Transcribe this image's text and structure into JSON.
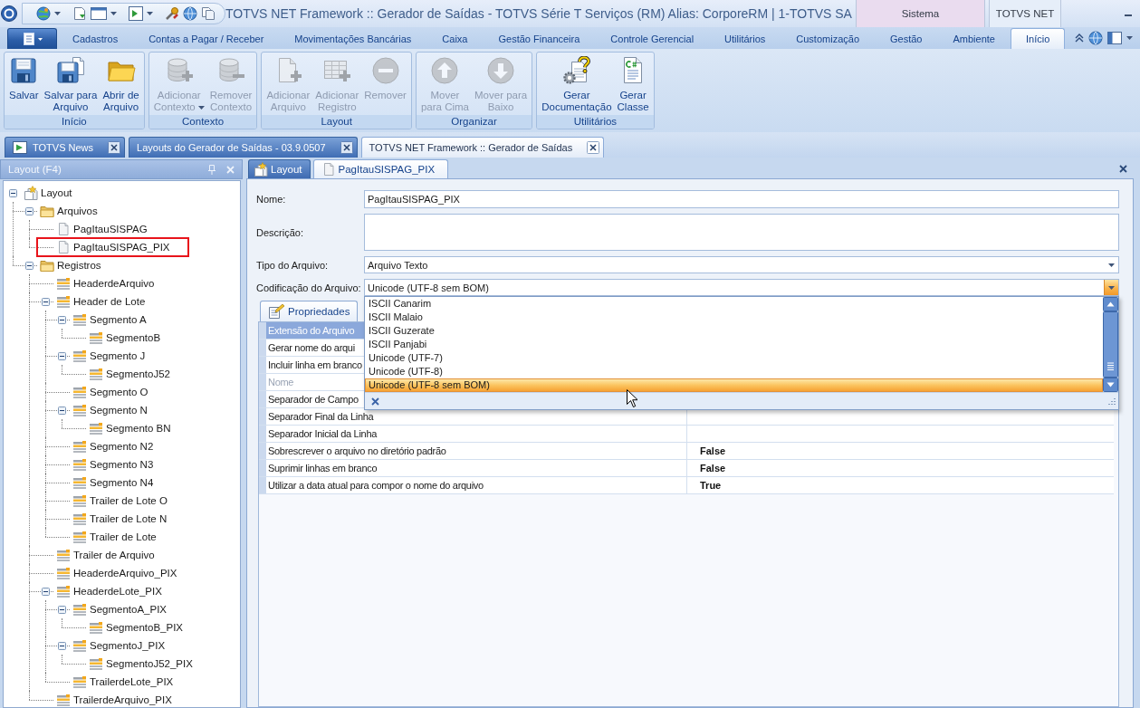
{
  "title_bar": {
    "title": "TOTVS NET Framework :: Gerador de Saídas - TOTVS Série T Serviços (RM) Alias: CorporeRM | 1-TOTVS SA",
    "context_groups": [
      {
        "label": "Sistema",
        "color": "#eadcef"
      },
      {
        "label": "TOTVS NET",
        "color": "#e6eef9"
      }
    ]
  },
  "menu_tabs": [
    {
      "label": "Cadastros",
      "selected": false
    },
    {
      "label": "Contas a Pagar / Receber",
      "selected": false
    },
    {
      "label": "Movimentações Bancárias",
      "selected": false
    },
    {
      "label": "Caixa",
      "selected": false
    },
    {
      "label": "Gestão Financeira",
      "selected": false
    },
    {
      "label": "Controle Gerencial",
      "selected": false
    },
    {
      "label": "Utilitários",
      "selected": false
    },
    {
      "label": "Customização",
      "selected": false
    },
    {
      "label": "Gestão",
      "selected": false
    },
    {
      "label": "Ambiente",
      "selected": false
    },
    {
      "label": "Início",
      "selected": true
    }
  ],
  "ribbon": {
    "groups": [
      {
        "label": "Início",
        "buttons": [
          {
            "label": "Salvar",
            "disabled": false,
            "menu": false
          },
          {
            "label": "Salvar para\nArquivo",
            "disabled": false,
            "menu": false
          },
          {
            "label": "Abrir de\nArquivo",
            "disabled": false,
            "menu": false
          }
        ]
      },
      {
        "label": "Contexto",
        "buttons": [
          {
            "label": "Adicionar\nContexto",
            "disabled": true,
            "menu": true
          },
          {
            "label": "Remover\nContexto",
            "disabled": true,
            "menu": false
          }
        ]
      },
      {
        "label": "Layout",
        "buttons": [
          {
            "label": "Adicionar\nArquivo",
            "disabled": true,
            "menu": false
          },
          {
            "label": "Adicionar\nRegistro",
            "disabled": true,
            "menu": false
          },
          {
            "label": "Remover",
            "disabled": true,
            "menu": false
          }
        ]
      },
      {
        "label": "Organizar",
        "buttons": [
          {
            "label": "Mover\npara Cima",
            "disabled": true,
            "menu": false
          },
          {
            "label": "Mover para\nBaixo",
            "disabled": true,
            "menu": false
          }
        ]
      },
      {
        "label": "Utilitários",
        "buttons": [
          {
            "label": "Gerar\nDocumentação",
            "disabled": false,
            "menu": false
          },
          {
            "label": "Gerar\nClasse",
            "disabled": false,
            "menu": false
          }
        ]
      }
    ]
  },
  "document_tabs": [
    {
      "label": "TOTVS News",
      "selected": false
    },
    {
      "label": "Layouts do Gerador de Saídas - 03.9.0507",
      "selected": false
    },
    {
      "label": "TOTVS NET Framework :: Gerador de Saídas",
      "selected": true
    }
  ],
  "layout_panel": {
    "title": "Layout (F4)",
    "tree": [
      {
        "label": "Layout",
        "kind": "layout",
        "expanded": true,
        "children": [
          {
            "label": "Arquivos",
            "kind": "folder",
            "expanded": true,
            "children": [
              {
                "label": "PagItauSISPAG",
                "kind": "file",
                "highlighted": false
              },
              {
                "label": "PagItauSISPAG_PIX",
                "kind": "file",
                "highlighted": true
              }
            ]
          },
          {
            "label": "Registros",
            "kind": "folder",
            "expanded": true,
            "children": [
              {
                "label": "HeaderdeArquivo",
                "kind": "record"
              },
              {
                "label": "Header de Lote",
                "kind": "record",
                "expanded": true,
                "children": [
                  {
                    "label": "Segmento A",
                    "kind": "record",
                    "expanded": true,
                    "children": [
                      {
                        "label": "SegmentoB",
                        "kind": "record"
                      }
                    ]
                  },
                  {
                    "label": "Segmento J",
                    "kind": "record",
                    "expanded": true,
                    "children": [
                      {
                        "label": "SegmentoJ52",
                        "kind": "record"
                      }
                    ]
                  },
                  {
                    "label": "Segmento O",
                    "kind": "record"
                  },
                  {
                    "label": "Segmento N",
                    "kind": "record",
                    "expanded": true,
                    "children": [
                      {
                        "label": "Segmento BN",
                        "kind": "record"
                      }
                    ]
                  },
                  {
                    "label": "Segmento N2",
                    "kind": "record"
                  },
                  {
                    "label": "Segmento N3",
                    "kind": "record"
                  },
                  {
                    "label": "Segmento N4",
                    "kind": "record"
                  },
                  {
                    "label": "Trailer de Lote O",
                    "kind": "record"
                  },
                  {
                    "label": "Trailer de Lote N",
                    "kind": "record"
                  },
                  {
                    "label": "Trailer de Lote",
                    "kind": "record"
                  }
                ]
              },
              {
                "label": "Trailer de Arquivo",
                "kind": "record"
              },
              {
                "label": "HeaderdeArquivo_PIX",
                "kind": "record"
              },
              {
                "label": "HeaderdeLote_PIX",
                "kind": "record",
                "expanded": true,
                "children": [
                  {
                    "label": "SegmentoA_PIX",
                    "kind": "record",
                    "expanded": true,
                    "children": [
                      {
                        "label": "SegmentoB_PIX",
                        "kind": "record"
                      }
                    ]
                  },
                  {
                    "label": "SegmentoJ_PIX",
                    "kind": "record",
                    "expanded": true,
                    "children": [
                      {
                        "label": "SegmentoJ52_PIX",
                        "kind": "record"
                      }
                    ]
                  },
                  {
                    "label": "TrailerdeLote_PIX",
                    "kind": "record"
                  }
                ]
              },
              {
                "label": "TrailerdeArquivo_PIX",
                "kind": "record"
              }
            ]
          }
        ]
      }
    ]
  },
  "editor": {
    "tabs": [
      {
        "label": "Layout",
        "selected": false
      },
      {
        "label": "PagItauSISPAG_PIX",
        "selected": true
      }
    ],
    "fields": [
      {
        "label": "Nome:",
        "kind": "text",
        "value": "PagItauSISPAG_PIX"
      },
      {
        "label": "Descrição:",
        "kind": "textarea"
      },
      {
        "label": "Tipo do Arquivo:",
        "kind": "combo",
        "value": "Arquivo Texto",
        "open": false
      },
      {
        "label": "Codificação do Arquivo:",
        "kind": "combo",
        "value": "Unicode (UTF-8 sem BOM)",
        "open": true,
        "options": [
          {
            "label": "ISCII Canarim",
            "selected": false
          },
          {
            "label": "ISCII Malaio",
            "selected": false
          },
          {
            "label": "ISCII Guzerate",
            "selected": false
          },
          {
            "label": "ISCII Panjabi",
            "selected": false
          },
          {
            "label": "Unicode (UTF-7)",
            "selected": false
          },
          {
            "label": "Unicode (UTF-8)",
            "selected": false
          },
          {
            "label": "Unicode (UTF-8 sem BOM)",
            "selected": true
          }
        ]
      }
    ],
    "properties": {
      "tabs": [
        {
          "label": "Propriedades",
          "selected": true
        }
      ],
      "rows": [
        {
          "name": "Extensão do Arquivo",
          "selected": true,
          "disabled": false
        },
        {
          "name": "Gerar nome do arqui",
          "selected": false,
          "disabled": false
        },
        {
          "name": "Incluir linha em branco",
          "selected": false,
          "disabled": false
        },
        {
          "name": "Nome",
          "selected": false,
          "disabled": true
        },
        {
          "name": "Separador de Campo",
          "selected": false,
          "disabled": false
        },
        {
          "name": "Separador Final da Linha",
          "selected": false,
          "disabled": false
        },
        {
          "name": "Separador Inicial da Linha",
          "selected": false,
          "disabled": false
        },
        {
          "name": "Sobrescrever o arquivo no diretório padrão",
          "value": "False",
          "selected": false,
          "disabled": false
        },
        {
          "name": "Suprimir linhas em branco",
          "value": "False",
          "selected": false,
          "disabled": false
        },
        {
          "name": "Utilizar a data atual para compor o nome do arquivo",
          "value": "True",
          "selected": false,
          "disabled": false
        }
      ]
    }
  }
}
